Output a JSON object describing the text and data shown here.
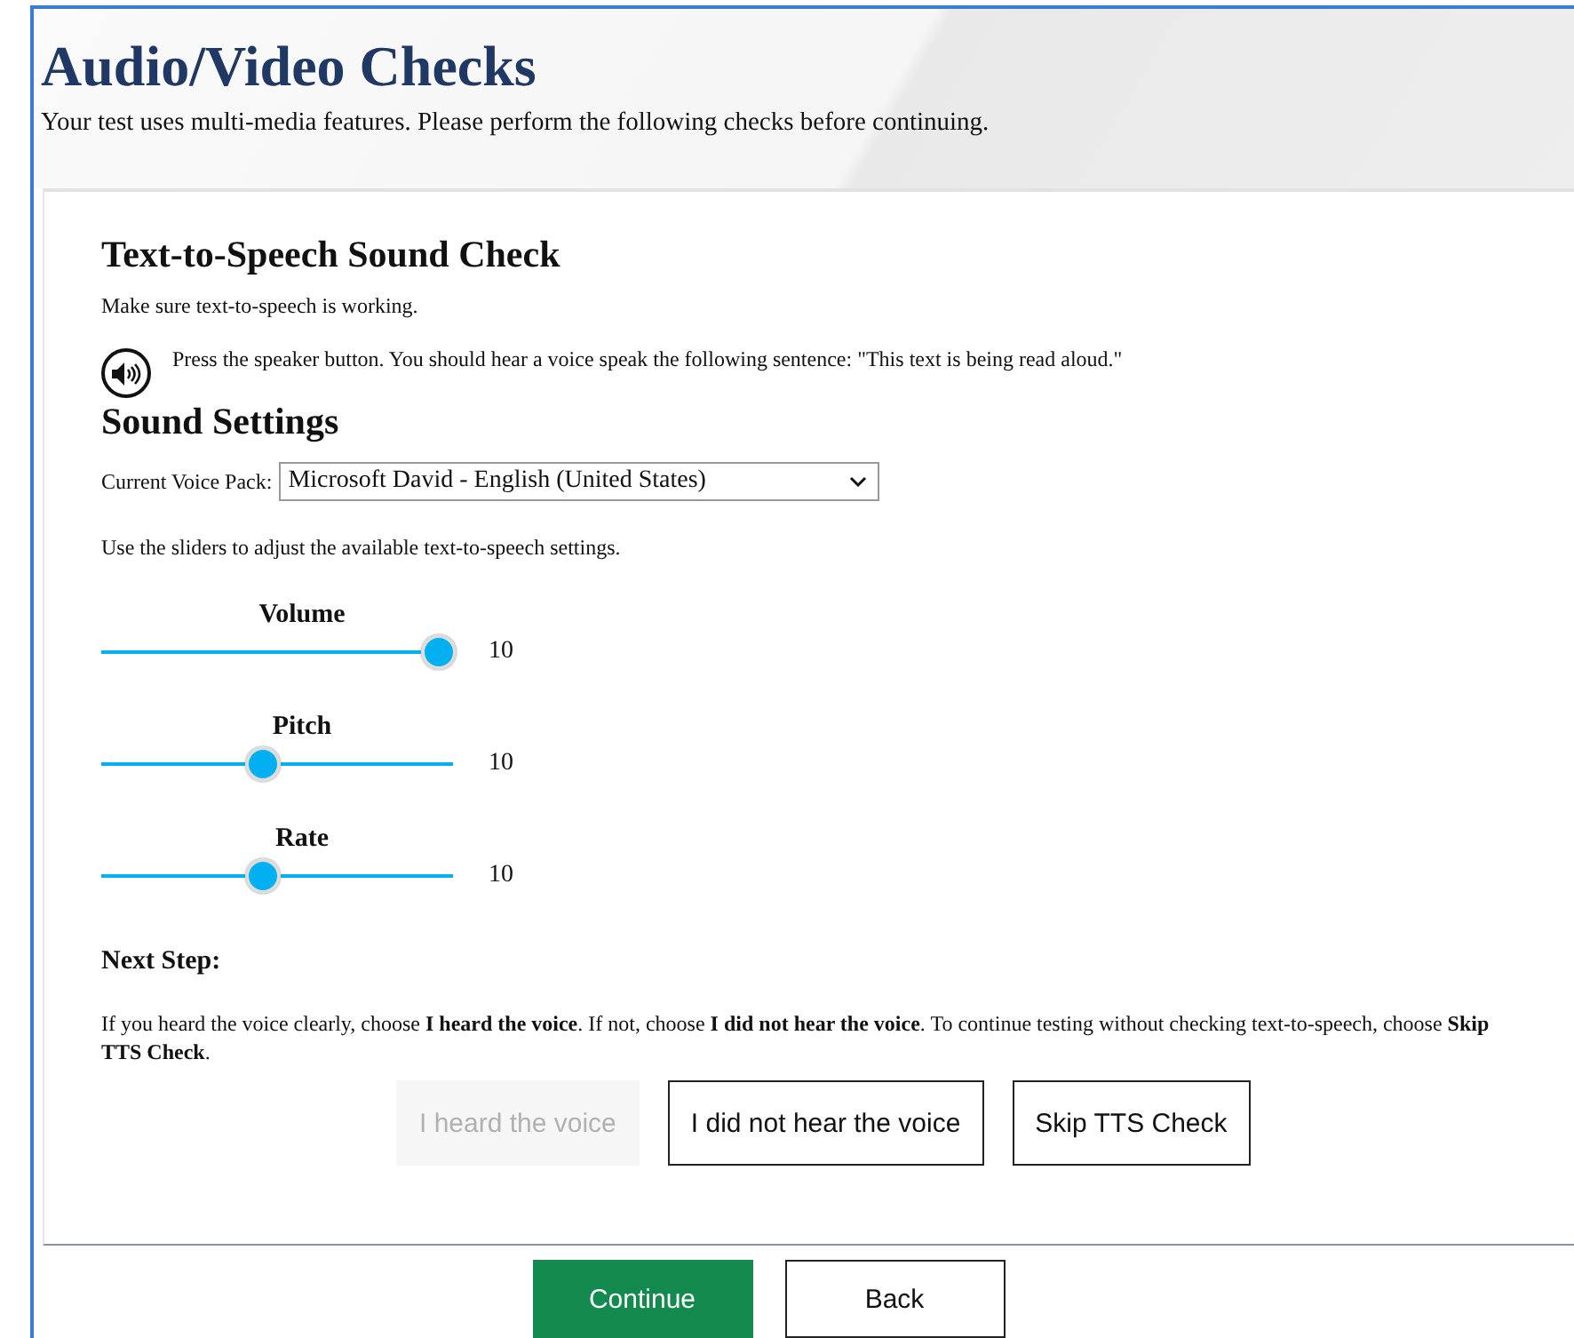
{
  "header": {
    "title": "Audio/Video Checks",
    "subtitle": "Your test uses multi-media features. Please perform the following checks before continuing."
  },
  "tts_check": {
    "title": "Text-to-Speech Sound Check",
    "intro": "Make sure text-to-speech is working.",
    "instruction": "Press the speaker button. You should hear a voice speak the following sentence: \"This text is being read aloud.\""
  },
  "sound_settings": {
    "title": "Sound Settings",
    "voice_pack_label": "Current Voice Pack:",
    "voice_pack_value": "Microsoft David - English (United States)",
    "hint": "Use the sliders to adjust the available text-to-speech settings.",
    "sliders": [
      {
        "label": "Volume",
        "level": 1,
        "reading": "10"
      },
      {
        "label": "Pitch",
        "level": 0.48,
        "reading": "10"
      },
      {
        "label": "Rate",
        "level": 0.48,
        "reading": "10"
      }
    ]
  },
  "next_step": {
    "title": "Next Step:",
    "text": "If you heard the voice clearly, choose **I heard the voice**. If not, choose **I did not hear the voice**. To continue testing without checking text-to-speech, choose **Skip TTS Check**.",
    "buttons": [
      {
        "label": "I heard the voice",
        "disabled": true
      },
      {
        "label": "I did not hear the voice",
        "disabled": false
      },
      {
        "label": "Skip TTS Check",
        "disabled": false
      }
    ]
  },
  "footer_buttons": [
    {
      "label": "Continue",
      "kind": "primary"
    },
    {
      "label": "Back",
      "kind": "secondary"
    }
  ]
}
